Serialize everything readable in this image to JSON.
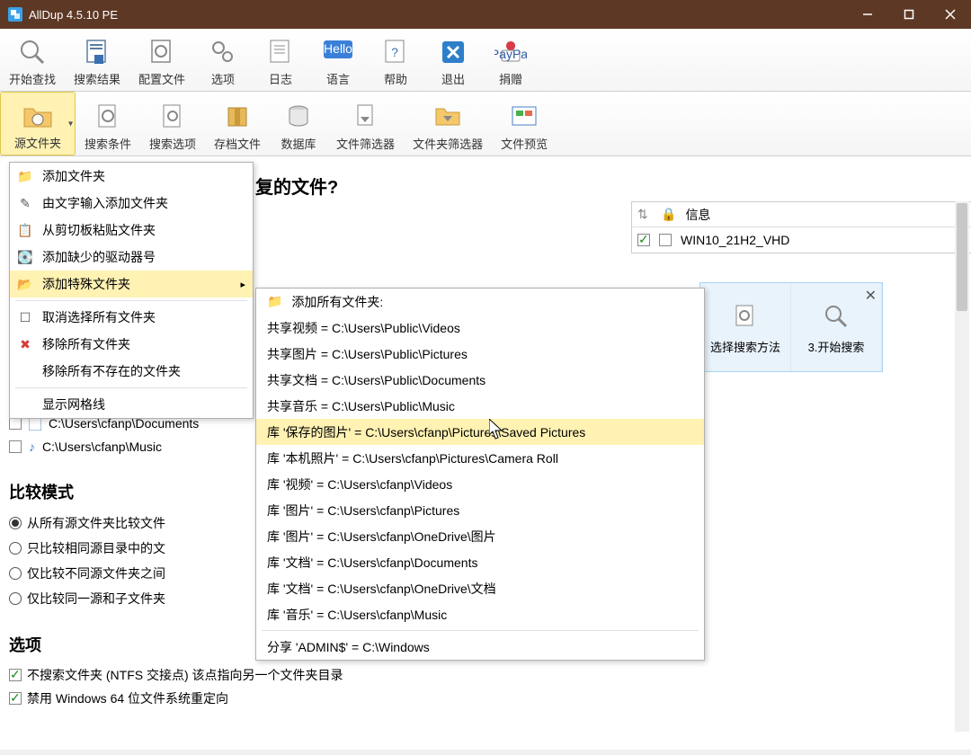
{
  "window": {
    "title": "AllDup 4.5.10 PE"
  },
  "toolbar1": {
    "start_search": "开始查找",
    "search_results": "搜索结果",
    "config_file": "配置文件",
    "options": "选项",
    "log": "日志",
    "language": "语言",
    "help": "帮助",
    "exit": "退出",
    "donate": "捐赠"
  },
  "toolbar2": {
    "source_folders": "源文件夹",
    "search_criteria": "搜索条件",
    "search_options": "搜索选项",
    "archive_files": "存档文件",
    "database": "数据库",
    "file_filter": "文件筛选器",
    "folder_filter": "文件夹筛选器",
    "file_preview": "文件预览"
  },
  "menu1": {
    "add_folder": "添加文件夹",
    "add_from_text": "由文字输入添加文件夹",
    "paste_from_clipboard": "从剪切板粘贴文件夹",
    "add_missing_drive": "添加缺少的驱动器号",
    "add_special_folder": "添加特殊文件夹",
    "deselect_all": "取消选择所有文件夹",
    "remove_all": "移除所有文件夹",
    "remove_nonexistent": "移除所有不存在的文件夹",
    "show_gridlines": "显示网格线"
  },
  "submenu": {
    "header": "添加所有文件夹:",
    "items": [
      "共享视频 = C:\\Users\\Public\\Videos",
      "共享图片 = C:\\Users\\Public\\Pictures",
      "共享文档 = C:\\Users\\Public\\Documents",
      "共享音乐 = C:\\Users\\Public\\Music",
      "库 '保存的图片' = C:\\Users\\cfanp\\Pictures\\Saved Pictures",
      "库 '本机照片' = C:\\Users\\cfanp\\Pictures\\Camera Roll",
      "库 '视频' = C:\\Users\\cfanp\\Videos",
      "库 '图片' = C:\\Users\\cfanp\\Pictures",
      "库 '图片' = C:\\Users\\cfanp\\OneDrive\\图片",
      "库 '文档' = C:\\Users\\cfanp\\Documents",
      "库 '文档' = C:\\Users\\cfanp\\OneDrive\\文档",
      "库 '音乐' = C:\\Users\\cfanp\\Music",
      "分享 'ADMIN$' = C:\\Windows"
    ],
    "highlighted_index": 4
  },
  "heading_fragment": "复的文件?",
  "info_table": {
    "col_info": "信息",
    "row1": "WIN10_21H2_VHD"
  },
  "folders": {
    "items": [
      "C:\\Users\\cfanp\\Documents",
      "C:\\Users\\cfanp\\Music"
    ]
  },
  "compare": {
    "title": "比较模式",
    "opt1": "从所有源文件夹比较文件",
    "opt2": "只比较相同源目录中的文",
    "opt3": "仅比较不同源文件夹之间",
    "opt4": "仅比较同一源和子文件夹"
  },
  "options_section": {
    "title": "选项",
    "opt1": "不搜索文件夹 (NTFS 交接点) 该点指向另一个文件夹目录",
    "opt2": "禁用 Windows 64 位文件系统重定向"
  },
  "overview": {
    "item1": "选择搜索方法",
    "item2": "3.开始搜索"
  }
}
